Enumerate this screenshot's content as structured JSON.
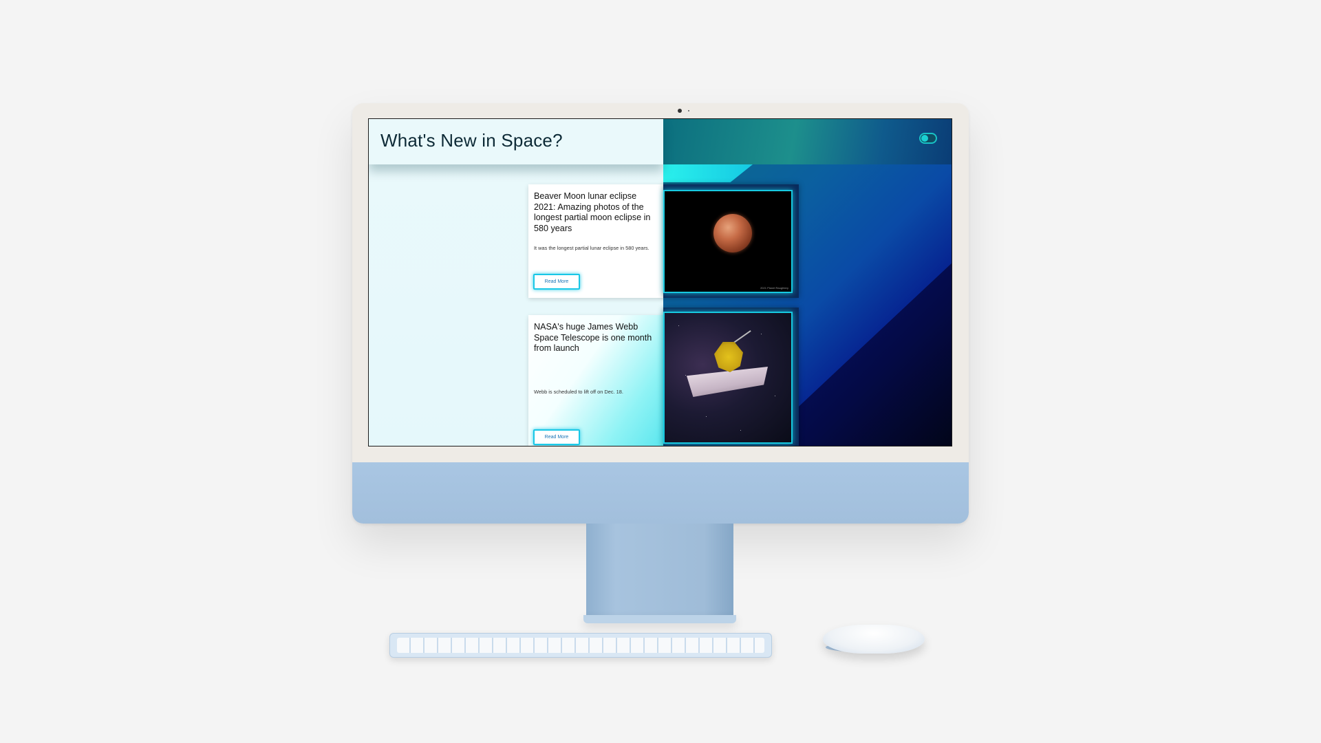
{
  "page": {
    "title": "What's New in Space?"
  },
  "toggle": {
    "icon": "toggle-switch-icon",
    "state": "off"
  },
  "articles": [
    {
      "title": "Beaver Moon lunar eclipse 2021: Amazing photos of the longest partial moon eclipse in 580 years",
      "description": "It was the longest partial lunar eclipse in 580 years.",
      "read_more": "Read More",
      "image": "lunar-eclipse-image",
      "image_credit": "2021 Planet Raughtery"
    },
    {
      "title": "NASA's huge James Webb Space Telescope is one month from launch",
      "description": "Webb is scheduled to lift off on Dec. 18.",
      "read_more": "Read More",
      "image": "james-webb-telescope-image"
    }
  ],
  "colors": {
    "accent_cyan": "#19c7e6",
    "title_text": "#0d2a36",
    "left_bg": "#eaf9fb",
    "right_bg_deep": "#05188a",
    "imac_chin": "#a9c6e3"
  }
}
